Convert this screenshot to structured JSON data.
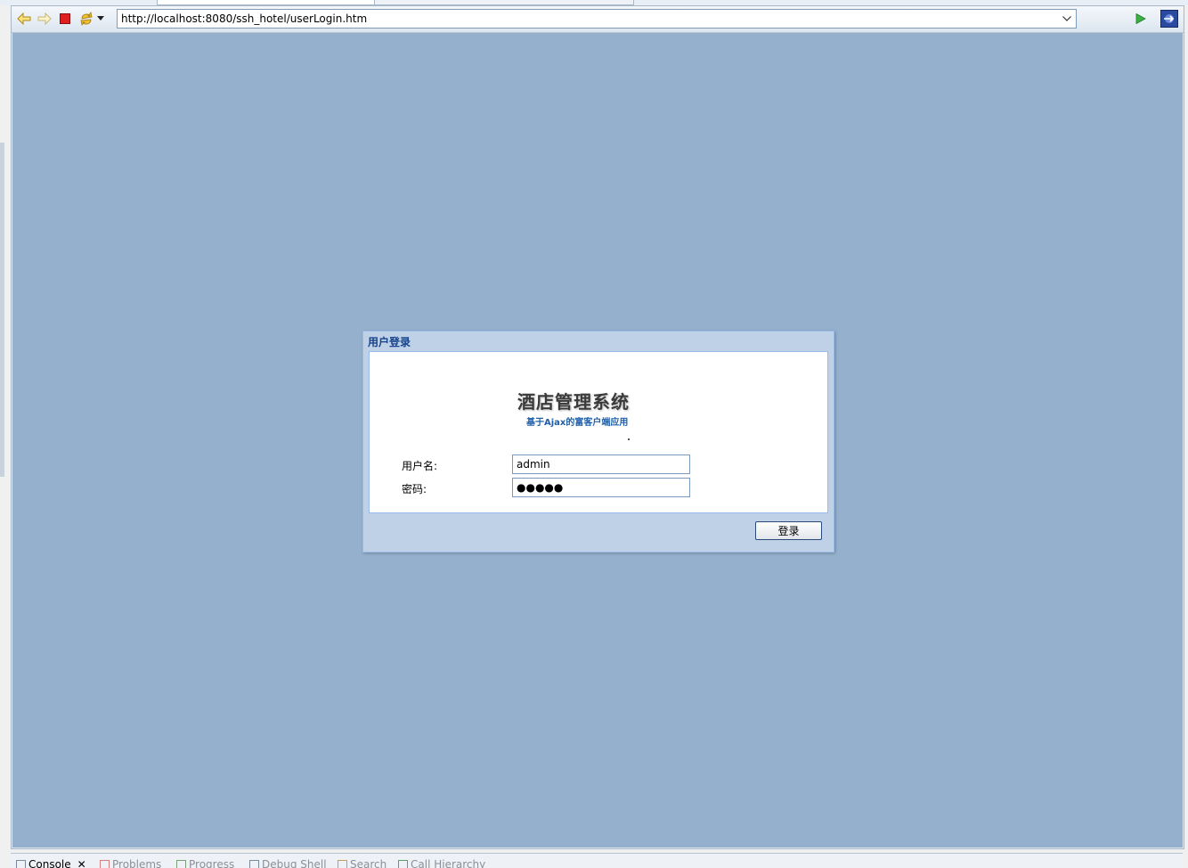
{
  "browser": {
    "url": "http://localhost:8080/ssh_hotel/userLogin.htm",
    "icons": [
      "back-icon",
      "forward-icon",
      "stop-icon",
      "refresh-icon",
      "menu-dropdown-icon",
      "url-dropdown-icon",
      "go-icon",
      "open-external-icon"
    ]
  },
  "dialog": {
    "title": "用户登录",
    "app_title": "酒店管理系统",
    "app_subtitle": "基于Ajax的富客户端应用",
    "username_label": "用户名:",
    "username_value": "admin",
    "password_label": "密码:",
    "password_value": "●●●●●",
    "login_button": "登录"
  },
  "bottom_tabs": [
    {
      "label": "Console",
      "icon": "console-icon"
    },
    {
      "label": "Problems",
      "icon": "problems-icon"
    },
    {
      "label": "Progress",
      "icon": "progress-icon"
    },
    {
      "label": "Debug Shell",
      "icon": "debug-shell-icon"
    },
    {
      "label": "Search",
      "icon": "search-icon"
    },
    {
      "label": "Call Hierarchy",
      "icon": "call-hierarchy-icon"
    }
  ],
  "colors": {
    "viewport_bg": "#94b0cd",
    "dialog_title": "#15428b",
    "subtitle": "#1f5fa8"
  }
}
